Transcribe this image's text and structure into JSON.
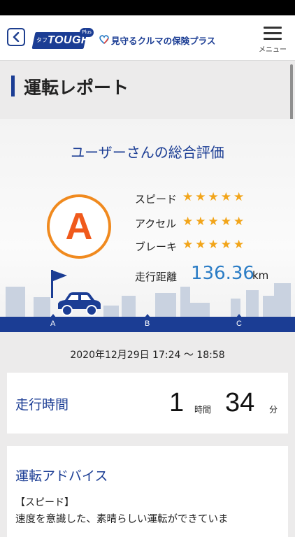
{
  "header": {
    "logo_tabu": "タフ",
    "logo_tough": "TOUGH",
    "logo_plus": "Plus",
    "tagline": "見守るクルマの保険プラス",
    "menu_label": "メニュー"
  },
  "page": {
    "title": "運転レポート"
  },
  "evaluation": {
    "title": "ユーザーさんの総合評価",
    "grade": "A",
    "ratings": [
      {
        "label": "スピード",
        "stars": "★★★★★",
        "score": 5,
        "max": 5
      },
      {
        "label": "アクセル",
        "stars": "★★★★★",
        "score": 5,
        "max": 5
      },
      {
        "label": "ブレーキ",
        "stars": "★★★★★",
        "score": 5,
        "max": 5
      }
    ],
    "distance_label": "走行距離",
    "distance_value": "136.36",
    "distance_unit": "km",
    "road_points": [
      "A",
      "B",
      "C"
    ]
  },
  "trip": {
    "date_range": "2020年12月29日 17:24 〜 18:58"
  },
  "drive_time": {
    "label": "走行時間",
    "hours": "1",
    "hours_unit": "時間",
    "minutes": "34",
    "minutes_unit": "分"
  },
  "advice": {
    "title": "運転アドバイス",
    "heading": "【スピード】",
    "text": "速度を意識した、素晴らしい運転ができていま"
  },
  "colors": {
    "brand_blue": "#1b3d94",
    "accent_orange": "#f08a1f",
    "star_gold": "#f2a51a",
    "value_blue": "#2a7cc5"
  }
}
